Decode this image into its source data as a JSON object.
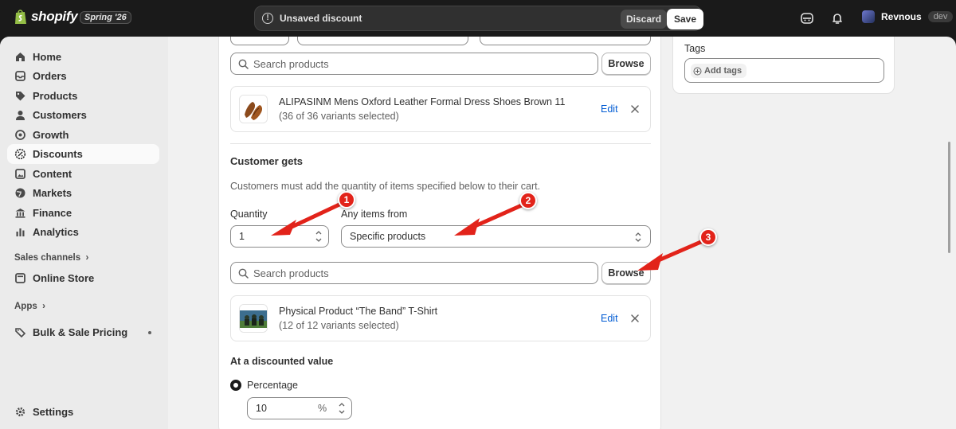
{
  "topbar": {
    "brand": "shopify",
    "edition": "Spring '26",
    "unsaved_message": "Unsaved discount",
    "discard_label": "Discard",
    "save_label": "Save",
    "user_name": "Revnous",
    "user_badge": "dev"
  },
  "sidebar": {
    "items": [
      {
        "label": "Home",
        "icon": "home-icon"
      },
      {
        "label": "Orders",
        "icon": "orders-icon"
      },
      {
        "label": "Products",
        "icon": "tag-icon"
      },
      {
        "label": "Customers",
        "icon": "person-icon"
      },
      {
        "label": "Growth",
        "icon": "target-icon"
      },
      {
        "label": "Discounts",
        "icon": "discount-icon",
        "active": true
      },
      {
        "label": "Content",
        "icon": "content-icon"
      },
      {
        "label": "Markets",
        "icon": "globe-icon"
      },
      {
        "label": "Finance",
        "icon": "bank-icon"
      },
      {
        "label": "Analytics",
        "icon": "bar-chart-icon"
      }
    ],
    "sales_channels_label": "Sales channels",
    "online_store_label": "Online Store",
    "apps_label": "Apps",
    "app_item_label": "Bulk & Sale Pricing",
    "settings_label": "Settings"
  },
  "buys": {
    "search_placeholder": "Search products",
    "browse_label": "Browse",
    "product": {
      "title": "ALIPASINM Mens Oxford Leather Formal Dress Shoes Brown 11",
      "variants": "(36 of 36 variants selected)",
      "edit_label": "Edit"
    }
  },
  "gets": {
    "heading": "Customer gets",
    "helper_text": "Customers must add the quantity of items specified below to their cart.",
    "quantity_label": "Quantity",
    "quantity_value": "1",
    "any_items_label": "Any items from",
    "any_items_value": "Specific products",
    "search_placeholder": "Search products",
    "browse_label": "Browse",
    "product": {
      "title": "Physical Product “The Band” T-Shirt",
      "variants": "(12 of 12 variants selected)",
      "edit_label": "Edit"
    }
  },
  "discounted_value": {
    "heading": "At a discounted value",
    "option_label": "Percentage",
    "percentage_value": "10",
    "suffix": "%"
  },
  "tags": {
    "label": "Tags",
    "add_label": "Add tags"
  },
  "annotations": [
    {
      "number": "1"
    },
    {
      "number": "2"
    },
    {
      "number": "3"
    }
  ],
  "colors": {
    "topbar_bg": "#1a1a1a",
    "annotation_red": "#e2231a",
    "link_blue": "#005bd3"
  }
}
